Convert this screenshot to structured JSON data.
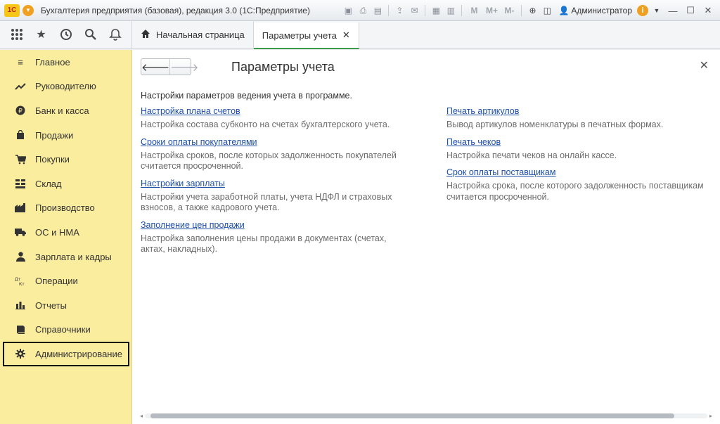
{
  "window": {
    "title": "Бухгалтерия предприятия (базовая), редакция 3.0  (1С:Предприятие)",
    "logo_text": "1С",
    "user": "Администратор",
    "toolbar_m": [
      "M",
      "M+",
      "M-"
    ]
  },
  "tabs": [
    {
      "label": "Начальная страница"
    },
    {
      "label": "Параметры учета",
      "active": true
    }
  ],
  "sidebar": {
    "items": [
      {
        "label": "Главное",
        "icon": "menu-lines-icon"
      },
      {
        "label": "Руководителю",
        "icon": "trend-icon"
      },
      {
        "label": "Банк и касса",
        "icon": "ruble-coin-icon"
      },
      {
        "label": "Продажи",
        "icon": "shopping-bag-icon"
      },
      {
        "label": "Покупки",
        "icon": "cart-icon"
      },
      {
        "label": "Склад",
        "icon": "warehouse-grid-icon"
      },
      {
        "label": "Производство",
        "icon": "factory-icon"
      },
      {
        "label": "ОС и НМА",
        "icon": "truck-icon"
      },
      {
        "label": "Зарплата и кадры",
        "icon": "person-icon"
      },
      {
        "label": "Операции",
        "icon": "dt-kt-icon"
      },
      {
        "label": "Отчеты",
        "icon": "bar-chart-icon"
      },
      {
        "label": "Справочники",
        "icon": "book-icon"
      },
      {
        "label": "Администрирование",
        "icon": "gear-icon",
        "active": true
      }
    ]
  },
  "main": {
    "title": "Параметры учета",
    "intro": "Настройки параметров ведения учета в программе.",
    "left": [
      {
        "link": "Настройка плана счетов",
        "desc": "Настройка состава субконто на счетах бухгалтерского учета."
      },
      {
        "link": "Сроки оплаты покупателями",
        "desc": "Настройка сроков, после которых задолженность покупателей считается просроченной."
      },
      {
        "link": "Настройки зарплаты",
        "desc": "Настройки учета заработной платы, учета НДФЛ и страховых взносов, а также кадрового учета."
      },
      {
        "link": "Заполнение цен продажи",
        "desc": "Настройка заполнения цены продажи в документах (счетах, актах, накладных)."
      }
    ],
    "right": [
      {
        "link": "Печать артикулов",
        "desc": "Вывод артикулов номенклатуры в печатных формах."
      },
      {
        "link": "Печать чеков",
        "desc": "Настройка печати чеков на онлайн кассе."
      },
      {
        "link": "Срок оплаты поставщикам",
        "desc": "Настройка срока, после которого задолженность поставщикам считается просроченной."
      }
    ]
  }
}
